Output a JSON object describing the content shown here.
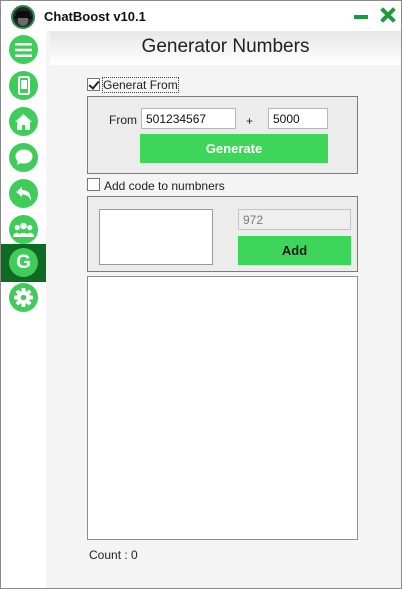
{
  "app": {
    "title": "ChatBoost  v10.1"
  },
  "page": {
    "title": "Generator Numbers"
  },
  "sidebar": {
    "items": [
      {
        "icon": "menu-icon",
        "active": false
      },
      {
        "icon": "phone-icon",
        "active": false
      },
      {
        "icon": "home-icon",
        "active": false
      },
      {
        "icon": "chat-bubble-icon",
        "active": false
      },
      {
        "icon": "back-arrow-icon",
        "active": false
      },
      {
        "icon": "group-icon",
        "active": false
      },
      {
        "icon": "generator-g-icon",
        "active": true,
        "label": "G"
      },
      {
        "icon": "settings-gear-icon",
        "active": false
      }
    ]
  },
  "generate_from": {
    "checkbox_label": "Generat From",
    "checked": true,
    "from_label": "From",
    "from_value": "501234567",
    "plus": "+",
    "amount_value": "5000",
    "button_label": "Generate"
  },
  "add_code": {
    "checkbox_label": "Add code to numbners",
    "checked": false,
    "code_placeholder": "972",
    "button_label": "Add"
  },
  "footer": {
    "count_label": "Count :",
    "count_value": "0"
  },
  "colors": {
    "accent_green": "#3ed65a",
    "active_nav": "#0f6a22",
    "title_icons": "#1e9a3a"
  }
}
